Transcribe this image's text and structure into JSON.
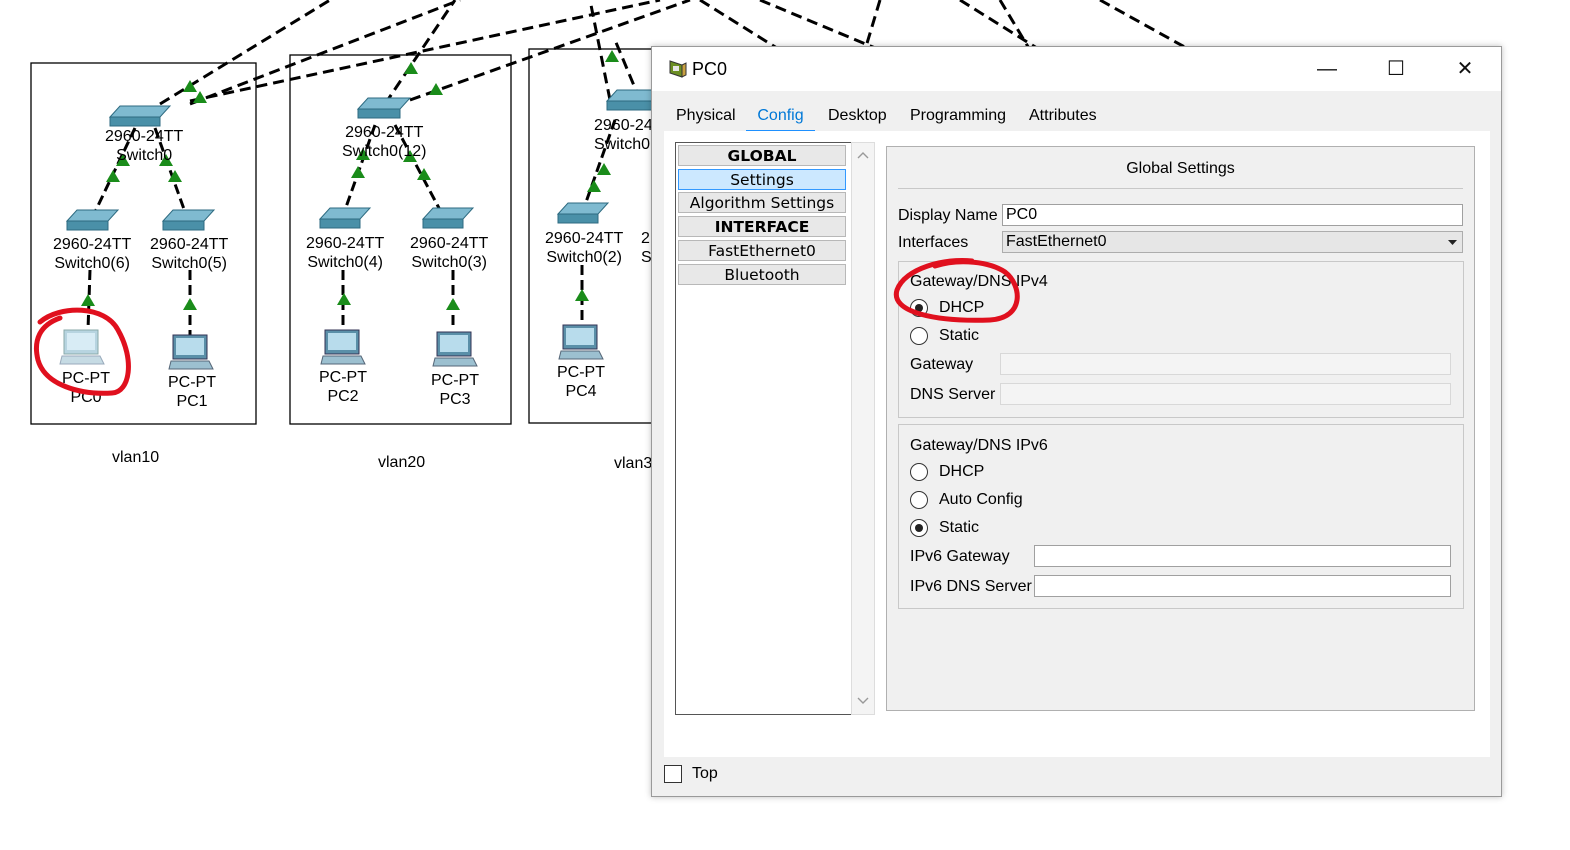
{
  "topology": {
    "devices": [
      {
        "model": "2960-24TT",
        "name": "Switch0"
      },
      {
        "model": "2960-24TT",
        "name": "Switch0(6)"
      },
      {
        "model": "2960-24TT",
        "name": "Switch0(5)"
      },
      {
        "model": "PC-PT",
        "name": "PC0"
      },
      {
        "model": "PC-PT",
        "name": "PC1"
      },
      {
        "model": "2960-24TT",
        "name": "Switch0(12)"
      },
      {
        "model": "2960-24TT",
        "name": "Switch0(4)"
      },
      {
        "model": "2960-24TT",
        "name": "Switch0(3)"
      },
      {
        "model": "PC-PT",
        "name": "PC2"
      },
      {
        "model": "PC-PT",
        "name": "PC3"
      },
      {
        "model": "2960-24",
        "name": "Switch0"
      },
      {
        "model": "2960-24TT",
        "name": "Switch0(2)"
      },
      {
        "model": "2",
        "name": "S"
      },
      {
        "model": "PC-PT",
        "name": "PC4"
      }
    ],
    "vlans": [
      "vlan10",
      "vlan20",
      "vlan3"
    ]
  },
  "window": {
    "title": "PC0",
    "minimize": "—",
    "maximize": "☐",
    "close": "✕",
    "tabs": [
      "Physical",
      "Config",
      "Desktop",
      "Programming",
      "Attributes"
    ],
    "active_tab": "Config"
  },
  "sidebar": {
    "items": [
      {
        "label": "GLOBAL",
        "type": "header"
      },
      {
        "label": "Settings",
        "type": "item",
        "selected": true
      },
      {
        "label": "Algorithm Settings",
        "type": "item"
      },
      {
        "label": "INTERFACE",
        "type": "header"
      },
      {
        "label": "FastEthernet0",
        "type": "item"
      },
      {
        "label": "Bluetooth",
        "type": "item"
      }
    ]
  },
  "settings": {
    "heading": "Global Settings",
    "display_name_label": "Display Name",
    "display_name_value": "PC0",
    "interfaces_label": "Interfaces",
    "interfaces_value": "FastEthernet0",
    "ipv4": {
      "title": "Gateway/DNS IPv4",
      "dhcp": "DHCP",
      "static": "Static",
      "selected": "DHCP",
      "gateway_label": "Gateway",
      "gateway_value": "",
      "dns_label": "DNS Server",
      "dns_value": ""
    },
    "ipv6": {
      "title": "Gateway/DNS IPv6",
      "dhcp": "DHCP",
      "auto": "Auto Config",
      "static": "Static",
      "selected": "Static",
      "gateway_label": "IPv6 Gateway",
      "gateway_value": "",
      "dns_label": "IPv6 DNS Server",
      "dns_value": ""
    }
  },
  "footer": {
    "top_label": "Top",
    "top_checked": false
  },
  "colors": {
    "link_green": "#1a8c1a",
    "switch_blue": "#4a90a8",
    "annotation_red": "#e0101e",
    "tab_active": "#0078d7"
  }
}
